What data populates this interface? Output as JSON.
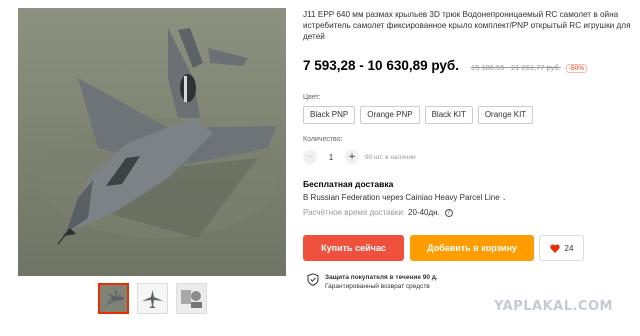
{
  "product": {
    "title": "J11 EPP 640 мм размах крыльев 3D трюк Водонепроницаемый RC самолет в ойна истребитель самолет фиксированное крыло комплект/PNP открытый RC игрушки для детей",
    "price": "7 593,28 - 10 630,89 руб.",
    "old_price": "15 186,55 - 21 261,77 руб.",
    "discount": "-50%"
  },
  "color": {
    "label": "Цвет:",
    "options": [
      "Black PNP",
      "Orange PNP",
      "Black KIT",
      "Orange KIT"
    ]
  },
  "quantity": {
    "label": "Количество:",
    "value": "1",
    "minus": "−",
    "plus": "+",
    "stock": "90 шт. в наличии"
  },
  "shipping": {
    "title": "Бесплатная доставка",
    "line": "В Russian Federation через Cainiao Heavy Parcel Line",
    "chevron": "⌄",
    "time_label": "Расчётное время доставки:",
    "time_value": "20-40дн.",
    "help": "?"
  },
  "actions": {
    "buy_label": "Купить сейчас",
    "cart_label": "Добавить в корзину",
    "wish_count": "24"
  },
  "protection": {
    "line1": "Защита покупателя в течение 90 д.",
    "line2": "Гарантированный возврат средств"
  },
  "watermark": "YAPLAKAL.COM",
  "colors": {
    "accent": "#e62e04",
    "buy_button": "#f0513e",
    "cart_button": "#ff9c00"
  }
}
